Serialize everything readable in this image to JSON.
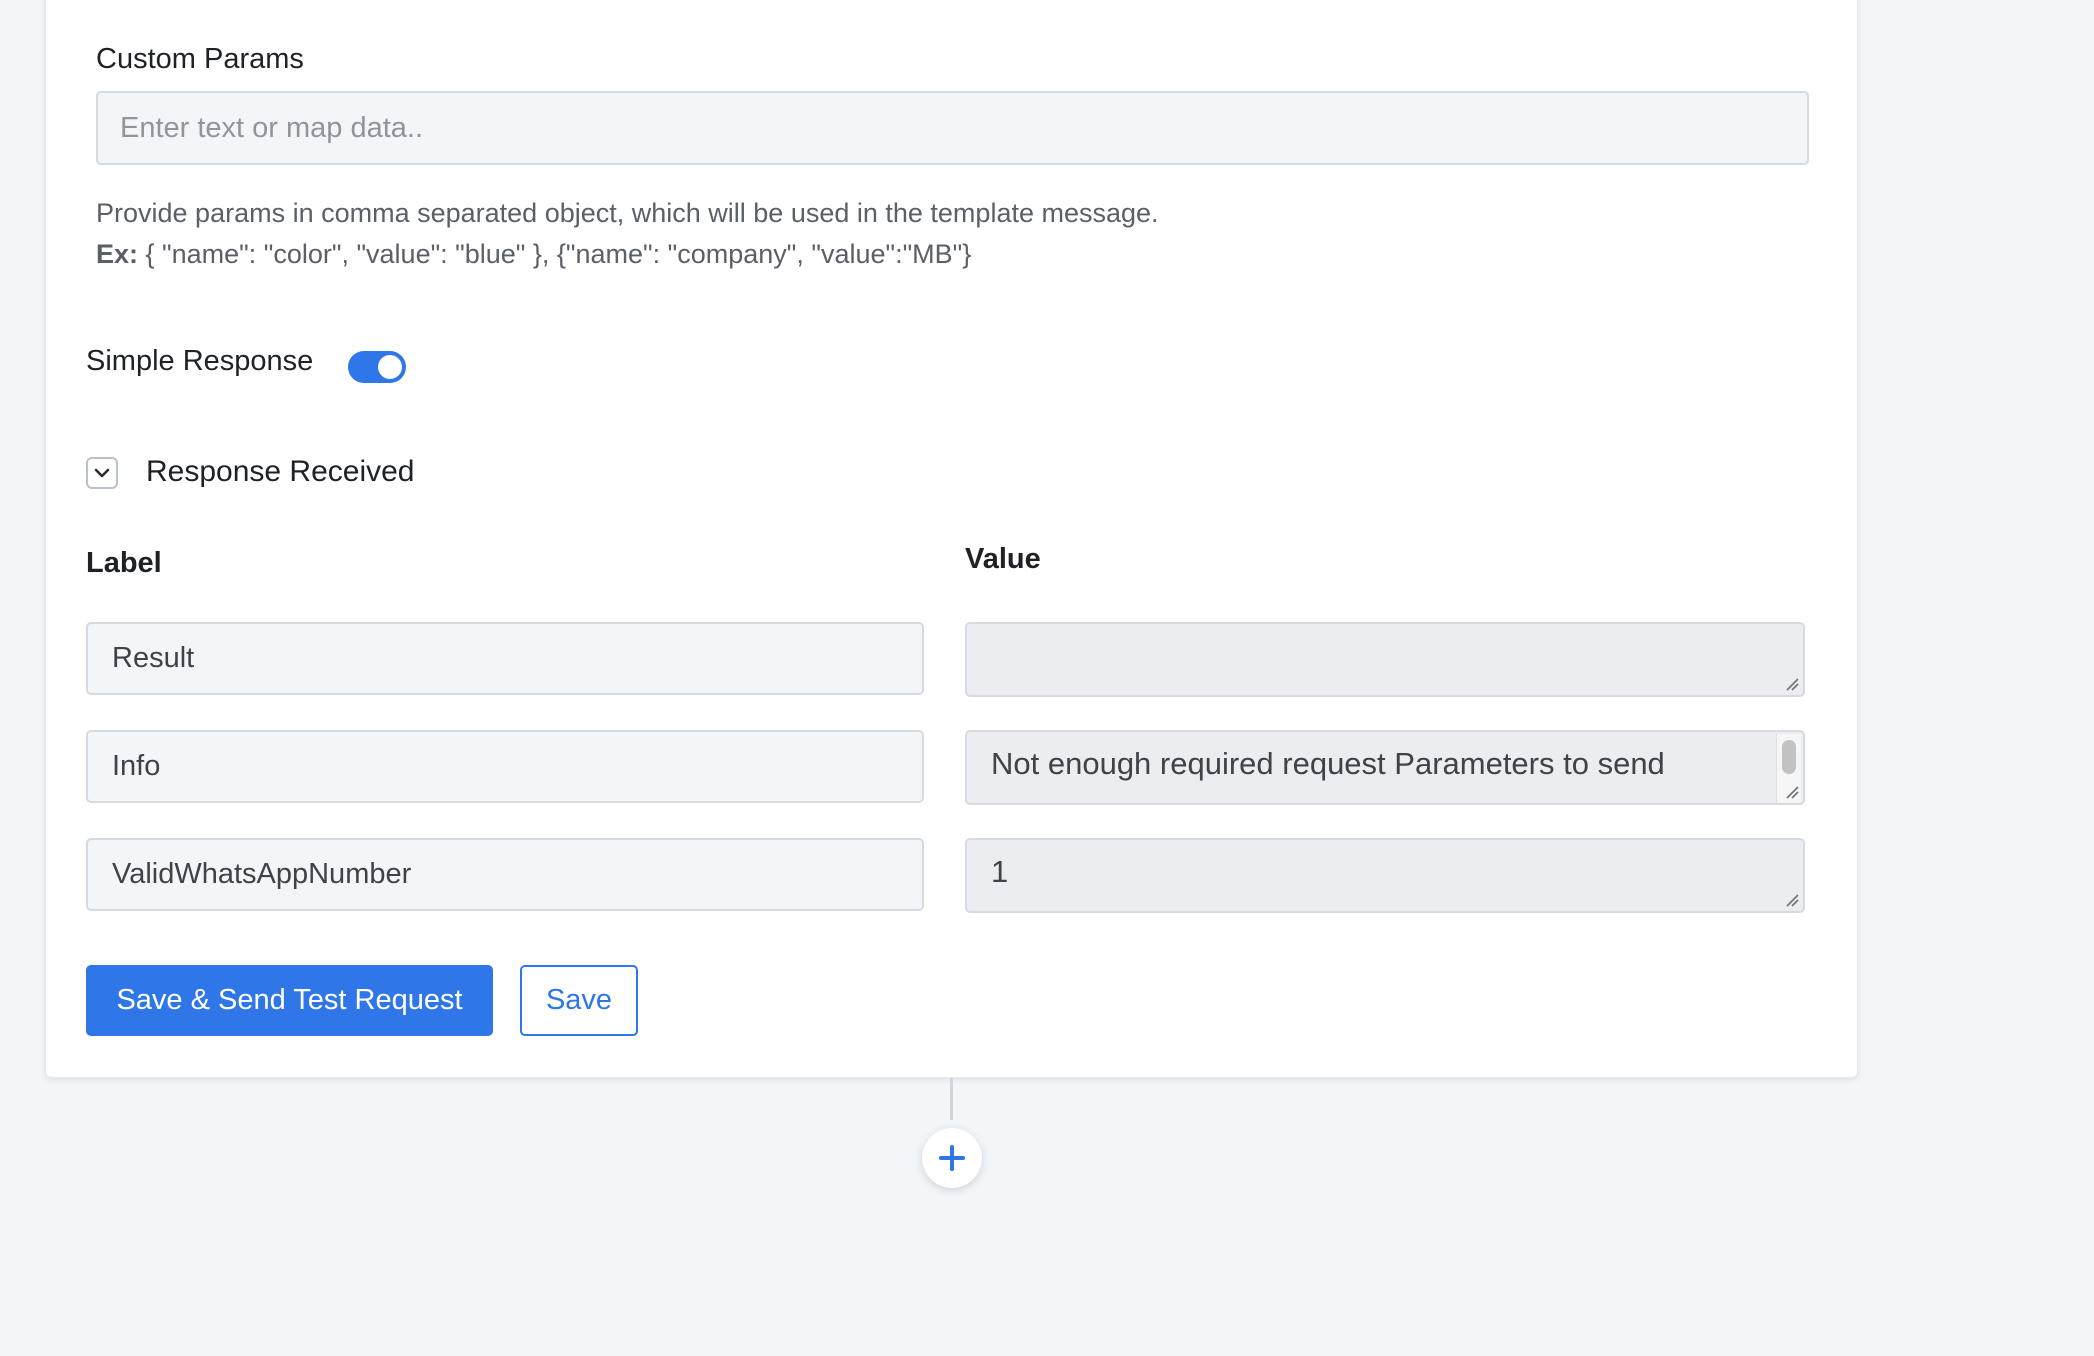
{
  "custom_params": {
    "title": "Custom Params",
    "placeholder": "Enter text or map data..",
    "value": "",
    "help_line1": "Provide params in comma separated object, which will be used in the template message.",
    "example_prefix": "Ex:",
    "example_text": " { \"name\": \"color\", \"value\": \"blue\" }, {\"name\": \"company\", \"value\":\"MB\"}"
  },
  "simple_response": {
    "label": "Simple Response",
    "enabled": true
  },
  "response_received": {
    "title": "Response Received",
    "expanded": true,
    "label_header": "Label",
    "value_header": "Value",
    "rows": [
      {
        "label": "Result",
        "value": ""
      },
      {
        "label": "Info",
        "value": "Not enough required request Parameters to send"
      },
      {
        "label": "ValidWhatsAppNumber",
        "value": "1"
      }
    ]
  },
  "actions": {
    "save_send_label": "Save & Send Test Request",
    "save_label": "Save"
  },
  "icons": {
    "toggle": "toggle-on-icon",
    "chevron": "chevron-down-icon",
    "add": "plus-icon"
  },
  "colors": {
    "accent": "#2f76e8",
    "background": "#f2f6f9",
    "card": "#ffffff"
  }
}
